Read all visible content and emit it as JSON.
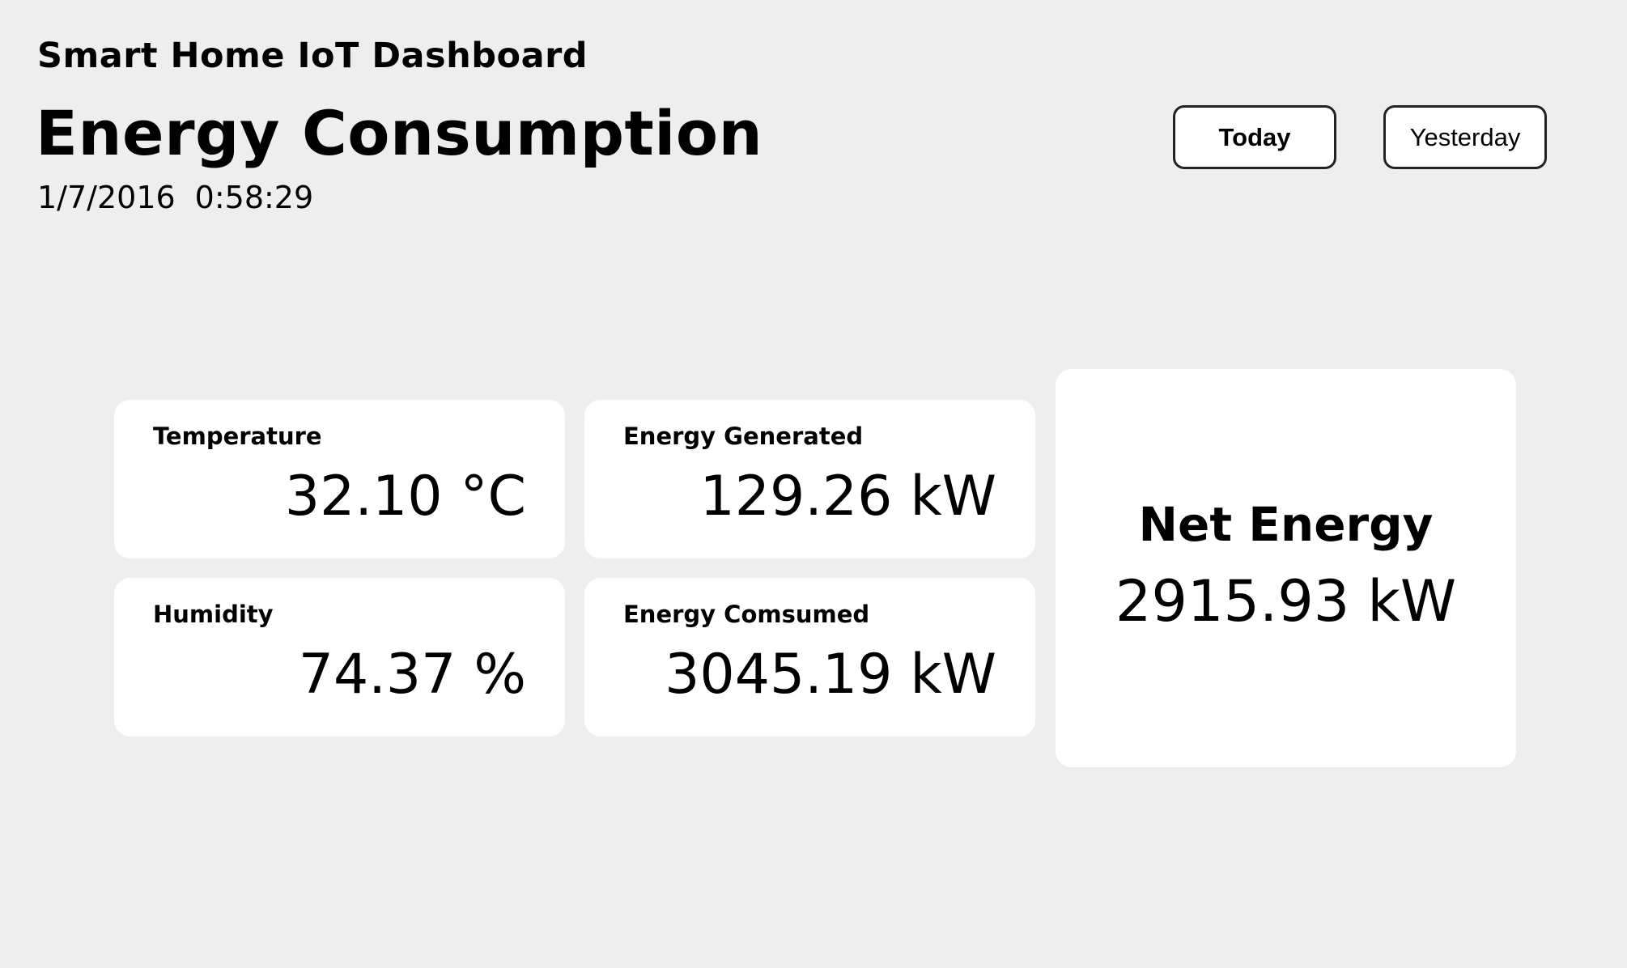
{
  "header": {
    "app_title": "Smart Home IoT Dashboard",
    "page_title": "Energy Consumption",
    "date": "1/7/2016",
    "time": "0:58:29"
  },
  "range_buttons": {
    "today": "Today",
    "yesterday": "Yesterday",
    "selected": "Today"
  },
  "metrics": {
    "temperature": {
      "label": "Temperature",
      "value": "32.10",
      "unit": "°C"
    },
    "energy_generated": {
      "label": "Energy Generated",
      "value": "129.26",
      "unit": "kW"
    },
    "humidity": {
      "label": "Humidity",
      "value": "74.37",
      "unit": "%"
    },
    "energy_consumed": {
      "label": "Energy Comsumed",
      "value": "3045.19",
      "unit": "kW"
    },
    "net_energy": {
      "label": "Net Energy",
      "value": "2915.93",
      "unit": "kW"
    }
  },
  "colors": {
    "background": "#eeeeee",
    "card": "#ffffff",
    "text": "#000000",
    "button_border": "#222222"
  }
}
